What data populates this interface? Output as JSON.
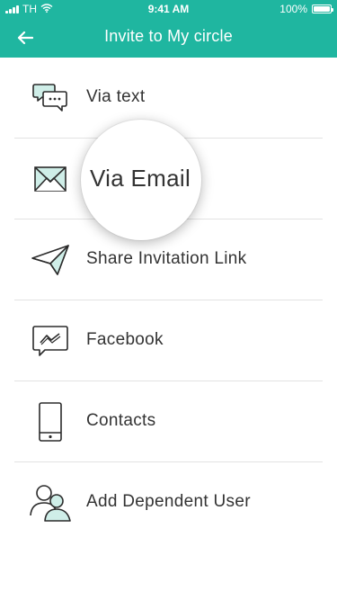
{
  "status": {
    "carrier": "TH",
    "time": "9:41 AM",
    "battery": "100%"
  },
  "header": {
    "title": "Invite to My circle"
  },
  "colors": {
    "header_bg": "#1fb6a0",
    "icon_accent": "#cfeee8",
    "icon_stroke": "#2b2b2b"
  },
  "items": [
    {
      "label": "Via text",
      "icon": "chat-bubbles-icon"
    },
    {
      "label": "Via Email",
      "icon": "envelope-icon"
    },
    {
      "label": "Share Invitation Link",
      "icon": "paper-plane-icon"
    },
    {
      "label": "Facebook",
      "icon": "messenger-icon"
    },
    {
      "label": "Contacts",
      "icon": "phone-icon"
    },
    {
      "label": "Add Dependent User",
      "icon": "users-icon"
    }
  ],
  "magnifier": {
    "text": "Via Email"
  }
}
